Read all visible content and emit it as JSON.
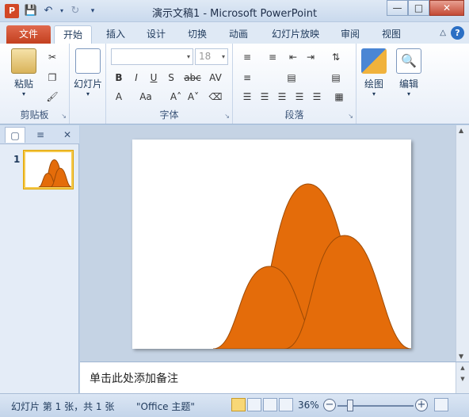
{
  "titlebar": {
    "title": "演示文稿1  -  Microsoft PowerPoint",
    "app_icon": "P"
  },
  "tabs": {
    "file": "文件",
    "items": [
      "开始",
      "插入",
      "设计",
      "切换",
      "动画",
      "幻灯片放映",
      "审阅",
      "视图"
    ]
  },
  "ribbon": {
    "clipboard": {
      "paste": "粘贴",
      "label": "剪贴板"
    },
    "slides": {
      "new_slide": "幻灯片"
    },
    "font": {
      "size": "18",
      "label": "字体"
    },
    "paragraph": {
      "label": "段落"
    },
    "drawing": {
      "label": "绘图"
    },
    "editing": {
      "label": "编辑"
    }
  },
  "left_panel": {
    "slide_number": "1"
  },
  "notes": {
    "placeholder": "单击此处添加备注"
  },
  "statusbar": {
    "slide_info": "幻灯片 第 1 张，共 1 张",
    "theme": "\"Office 主题\"",
    "zoom": "36%"
  },
  "colors": {
    "shape_fill": "#e46c0a",
    "shape_stroke": "#9c4a06"
  }
}
